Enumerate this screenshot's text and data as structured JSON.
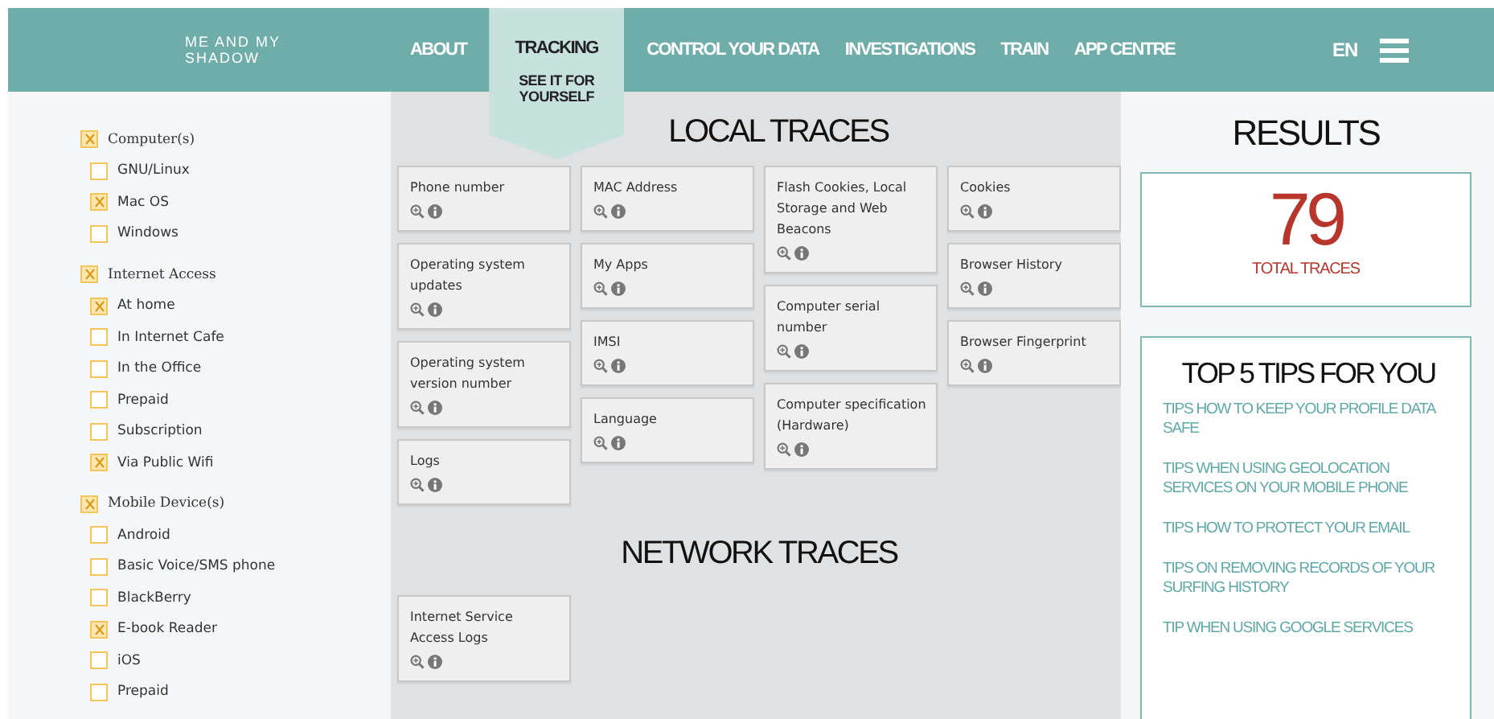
{
  "header": {
    "logo": {
      "line_1": "ME AND MY",
      "line_2": "SHADOW"
    },
    "nav": [
      {
        "label": "ABOUT",
        "selected": false
      },
      {
        "label": "TRACKING",
        "selected": true,
        "subtitle": "SEE IT FOR YOURSELF"
      },
      {
        "label": "CONTROL YOUR DATA",
        "selected": false
      },
      {
        "label": "INVESTIGATIONS",
        "selected": false
      },
      {
        "label": "TRAIN",
        "selected": false
      },
      {
        "label": "APP CENTRE",
        "selected": false
      }
    ],
    "language": "EN"
  },
  "filters": [
    {
      "label": "Computer(s)",
      "checked": true,
      "children": [
        {
          "label": "GNU/Linux",
          "checked": false
        },
        {
          "label": "Mac OS",
          "checked": true
        },
        {
          "label": "Windows",
          "checked": false
        }
      ]
    },
    {
      "label": "Internet Access",
      "checked": true,
      "children": [
        {
          "label": "At home",
          "checked": true
        },
        {
          "label": "In Internet Cafe",
          "checked": false
        },
        {
          "label": "In the Office",
          "checked": false
        },
        {
          "label": "Prepaid",
          "checked": false
        },
        {
          "label": "Subscription",
          "checked": false
        },
        {
          "label": "Via Public Wifi",
          "checked": true
        }
      ]
    },
    {
      "label": "Mobile Device(s)",
      "checked": true,
      "children": [
        {
          "label": "Android",
          "checked": false
        },
        {
          "label": "Basic Voice/SMS phone",
          "checked": false
        },
        {
          "label": "BlackBerry",
          "checked": false
        },
        {
          "label": "E-book Reader",
          "checked": true
        },
        {
          "label": "iOS",
          "checked": false
        },
        {
          "label": "Prepaid",
          "checked": false
        }
      ]
    }
  ],
  "local_traces": {
    "title": "LOCAL TRACES",
    "columns": [
      {
        "cards": [
          {
            "label": "Phone number"
          },
          {
            "label": "Operating system updates"
          },
          {
            "label": "Operating system version number"
          },
          {
            "label": "Logs"
          }
        ]
      },
      {
        "cards": [
          {
            "label": "MAC Address"
          },
          {
            "label": "My Apps"
          },
          {
            "label": "IMSI"
          },
          {
            "label": "Language"
          }
        ]
      },
      {
        "cards": [
          {
            "label": "Flash Cookies, Local Storage and Web Beacons"
          },
          {
            "label": "Computer serial number"
          },
          {
            "label": "Computer specification (Hardware)"
          }
        ]
      },
      {
        "cards": [
          {
            "label": "Cookies"
          },
          {
            "label": "Browser History"
          },
          {
            "label": "Browser Fingerprint"
          }
        ]
      }
    ]
  },
  "network_traces": {
    "title": "NETWORK TRACES",
    "cards": [
      {
        "label": "Internet Service Access Logs"
      }
    ]
  },
  "results": {
    "title": "RESULTS",
    "count": "79",
    "caption": "TOTAL TRACES"
  },
  "tips": {
    "title": "TOP 5 TIPS FOR YOU",
    "items": [
      "TIPS HOW TO KEEP YOUR PROFILE DATA SAFE",
      "TIPS WHEN USING GEOLOCATION SERVICES ON YOUR MOBILE PHONE",
      "TIPS HOW TO PROTECT YOUR EMAIL",
      "TIPS ON REMOVING RECORDS OF YOUR SURFING HISTORY",
      "TIP WHEN USING GOOGLE SERVICES"
    ]
  }
}
